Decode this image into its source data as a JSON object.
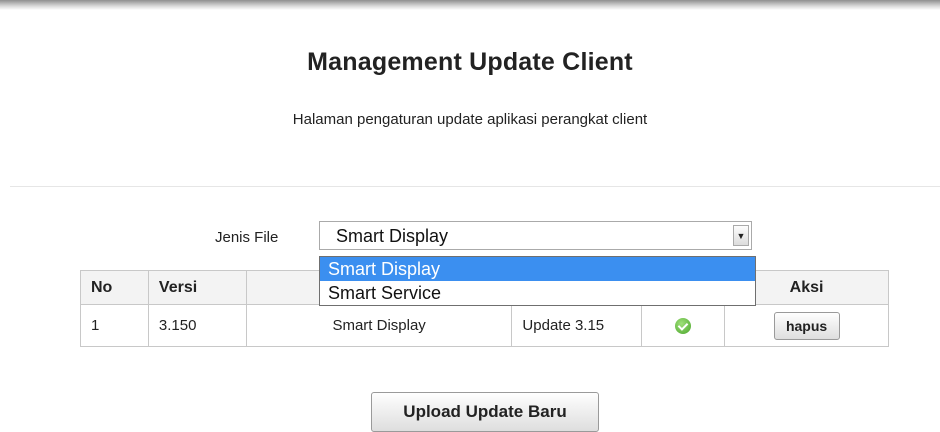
{
  "header": {
    "title": "Management Update Client",
    "subtitle": "Halaman pengaturan update aplikasi perangkat client"
  },
  "filter": {
    "label": "Jenis File",
    "selected_value": "Smart Display",
    "options": [
      "Smart Display",
      "Smart Service"
    ]
  },
  "table": {
    "columns": {
      "no": "No",
      "versi": "Versi",
      "jenis": "",
      "keterangan": "",
      "status": "",
      "aksi": "Aksi"
    },
    "rows": [
      {
        "no": "1",
        "versi": "3.150",
        "jenis": "Smart Display",
        "keterangan": "Update 3.15",
        "status_icon": "check-circle-icon",
        "action_label": "hapus"
      }
    ]
  },
  "actions": {
    "upload_label": "Upload Update Baru"
  },
  "colors": {
    "selected_option_bg": "#3b8ff0",
    "status_ok": "#4aa52b"
  }
}
